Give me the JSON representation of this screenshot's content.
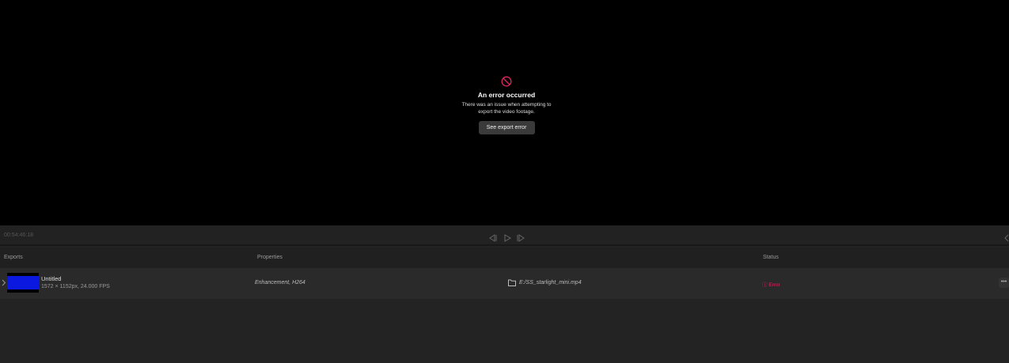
{
  "preview": {
    "error": {
      "icon": "prohibited-icon",
      "title": "An error occurred",
      "description_line1": "There was an issue when attempting to",
      "description_line2": "export the video footage.",
      "button": "See export error"
    }
  },
  "transport": {
    "timecode": "00:54:46:18",
    "controls": [
      "step-back-icon",
      "play-icon",
      "step-forward-icon"
    ]
  },
  "table": {
    "headers": {
      "exports": "Exports",
      "properties": "Properties",
      "status": "Status"
    },
    "rows": [
      {
        "name": "Untitled",
        "meta": "1572 × 1152px, 24.000 FPS",
        "properties": "Enhancement, H264",
        "path": "E:/SS_starlight_mini.mp4",
        "status": "Error"
      }
    ]
  },
  "colors": {
    "error": "#e0245e",
    "background": "#232323"
  }
}
